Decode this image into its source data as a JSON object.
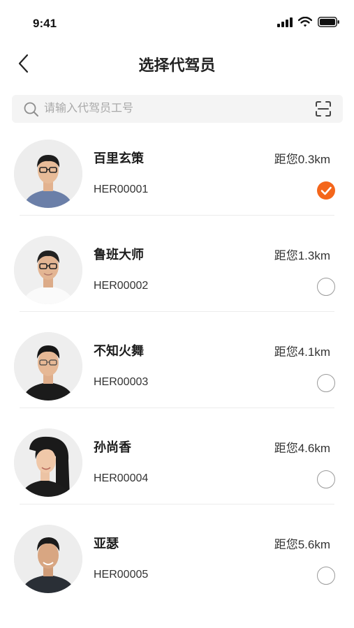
{
  "status_bar": {
    "time": "9:41",
    "icons": [
      "signal-icon",
      "wifi-icon",
      "battery-icon"
    ]
  },
  "nav": {
    "back_icon": "chevron-left-icon",
    "title": "选择代驾员"
  },
  "search": {
    "placeholder": "请输入代驾员工号",
    "value": "",
    "icons": [
      "search-icon",
      "scan-icon"
    ]
  },
  "drivers": [
    {
      "name": "百里玄策",
      "code": "HER00001",
      "distance": "距您0.3km",
      "selected": true
    },
    {
      "name": "鲁班大师",
      "code": "HER00002",
      "distance": "距您1.3km",
      "selected": false
    },
    {
      "name": "不知火舞",
      "code": "HER00003",
      "distance": "距您4.1km",
      "selected": false
    },
    {
      "name": "孙尚香",
      "code": "HER00004",
      "distance": "距您4.6km",
      "selected": false
    },
    {
      "name": "亚瑟",
      "code": "HER00005",
      "distance": "距您5.6km",
      "selected": false
    }
  ],
  "colors": {
    "accent": "#f4661b",
    "search_bg": "#f4f4f4",
    "divider": "#ececec"
  }
}
